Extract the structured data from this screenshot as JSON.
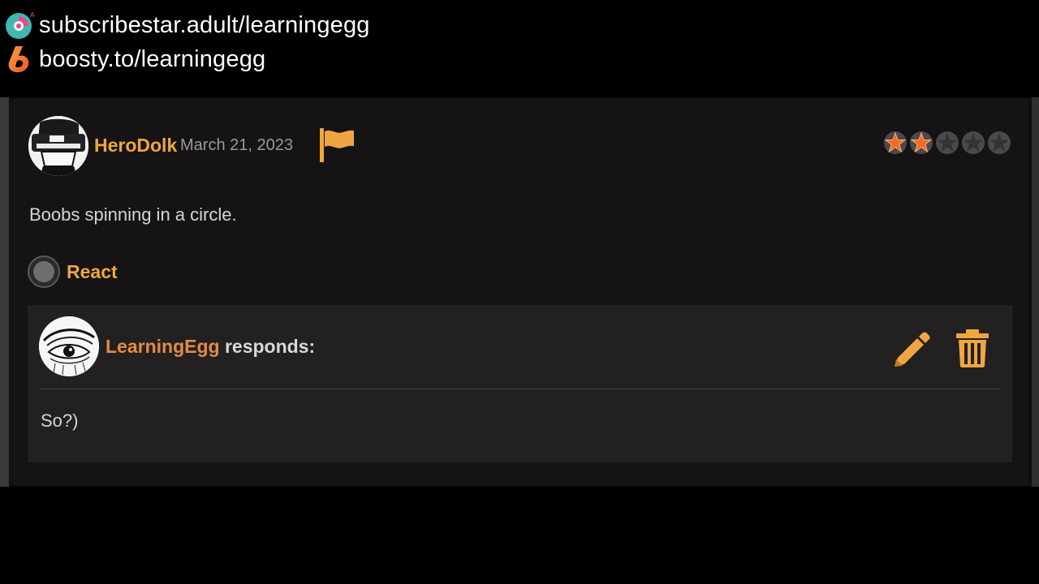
{
  "promo_links": [
    {
      "text": "subscribestar.adult/learningegg",
      "icon": "subscribestar-logo-icon"
    },
    {
      "text": "boosty.to/learningegg",
      "icon": "boosty-logo-icon"
    }
  ],
  "review": {
    "author": "HeroDolk",
    "date": "March 21, 2023",
    "rating": 2,
    "rating_max": 5,
    "text": "Boobs spinning in a circle.",
    "react_label": "React"
  },
  "response": {
    "author": "LearningEgg",
    "suffix": " responds:",
    "text": "So?)"
  },
  "colors": {
    "accent": "#f0a640",
    "responder": "#e38b45",
    "star_filled": "#f26a2a",
    "star_empty": "#3a3a3a",
    "background": "#000000",
    "card": "#151314",
    "response_bg": "#222021"
  }
}
